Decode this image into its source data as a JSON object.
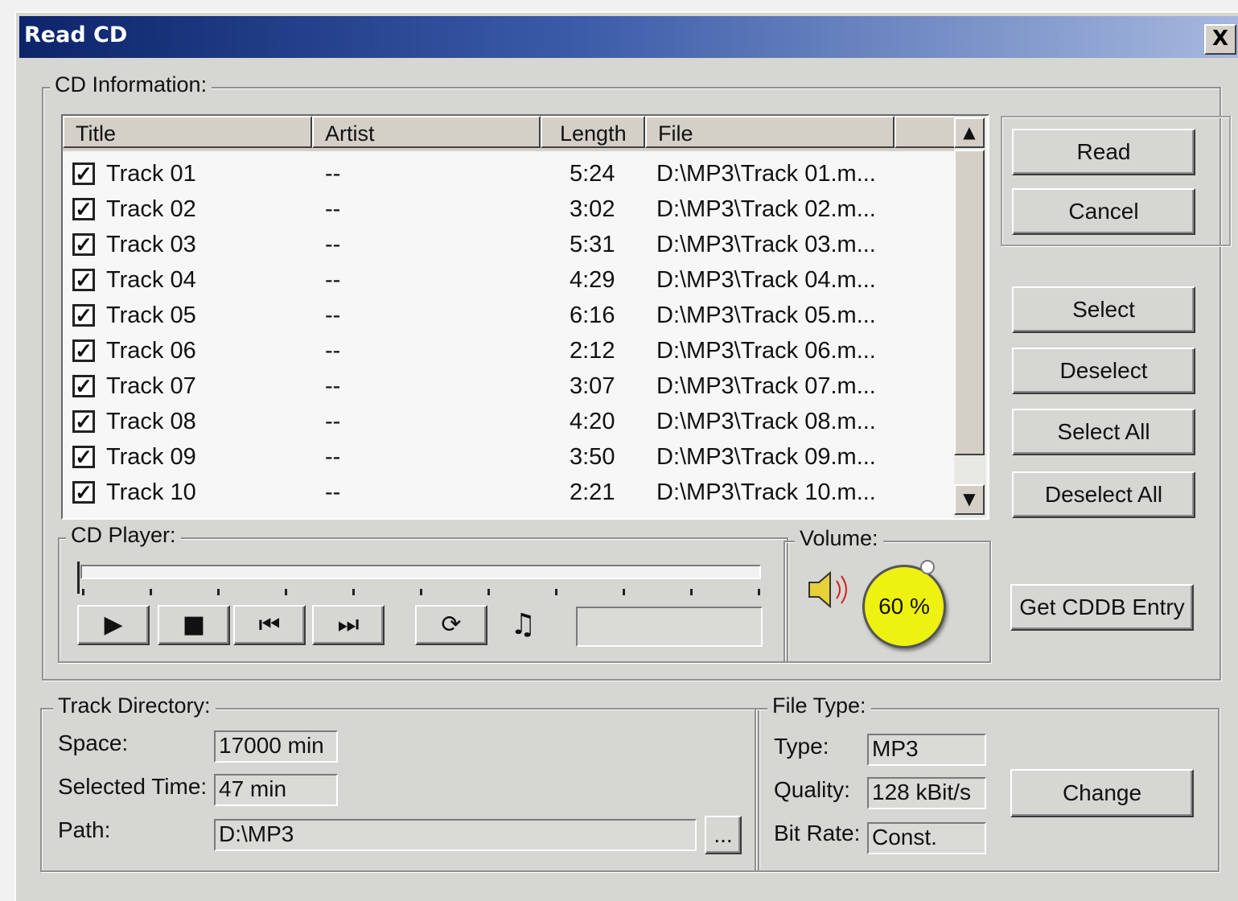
{
  "window": {
    "title": "Read CD",
    "close_label": "X"
  },
  "cd_info": {
    "label": "CD Information:",
    "columns": [
      "Title",
      "Artist",
      "Length",
      "File"
    ],
    "tracks": [
      {
        "title": "Track 01",
        "artist": "--",
        "length": "5:24",
        "file": "D:\\MP3\\Track 01.m...",
        "checked": true
      },
      {
        "title": "Track 02",
        "artist": "--",
        "length": "3:02",
        "file": "D:\\MP3\\Track 02.m...",
        "checked": true
      },
      {
        "title": "Track 03",
        "artist": "--",
        "length": "5:31",
        "file": "D:\\MP3\\Track 03.m...",
        "checked": true
      },
      {
        "title": "Track 04",
        "artist": "--",
        "length": "4:29",
        "file": "D:\\MP3\\Track 04.m...",
        "checked": true
      },
      {
        "title": "Track 05",
        "artist": "--",
        "length": "6:16",
        "file": "D:\\MP3\\Track 05.m...",
        "checked": true
      },
      {
        "title": "Track 06",
        "artist": "--",
        "length": "2:12",
        "file": "D:\\MP3\\Track 06.m...",
        "checked": true
      },
      {
        "title": "Track 07",
        "artist": "--",
        "length": "3:07",
        "file": "D:\\MP3\\Track 07.m...",
        "checked": true
      },
      {
        "title": "Track 08",
        "artist": "--",
        "length": "4:20",
        "file": "D:\\MP3\\Track 08.m...",
        "checked": true
      },
      {
        "title": "Track 09",
        "artist": "--",
        "length": "3:50",
        "file": "D:\\MP3\\Track 09.m...",
        "checked": true
      },
      {
        "title": "Track 10",
        "artist": "--",
        "length": "2:21",
        "file": "D:\\MP3\\Track 10.m...",
        "checked": true
      }
    ]
  },
  "buttons": {
    "read": "Read",
    "cancel": "Cancel",
    "select": "Select",
    "deselect": "Deselect",
    "select_all": "Select All",
    "deselect_all": "Deselect All",
    "cddb": "Get CDDB Entry",
    "change": "Change",
    "browse": "..."
  },
  "cd_player": {
    "label": "CD Player:",
    "position": 0,
    "icons": [
      "play-icon",
      "stop-icon",
      "previous-track-icon",
      "next-track-icon",
      "repeat-icon",
      "music-note-icon"
    ],
    "display": ""
  },
  "volume": {
    "label": "Volume:",
    "value": "60 %",
    "level": 0.6
  },
  "track_directory": {
    "label": "Track Directory:",
    "space_label": "Space:",
    "space_value": "17000 min",
    "selected_label": "Selected Time:",
    "selected_value": "47 min",
    "path_label": "Path:",
    "path_value": "D:\\MP3"
  },
  "file_type": {
    "label": "File Type:",
    "type_label": "Type:",
    "type_value": "MP3",
    "quality_label": "Quality:",
    "quality_value": "128 kBit/s",
    "bitrate_label": "Bit Rate:",
    "bitrate_value": "Const."
  },
  "colors": {
    "title_start": "#0c246a",
    "title_end": "#a6b8de",
    "knob": "#eef210",
    "face": "#d6d6d2"
  }
}
